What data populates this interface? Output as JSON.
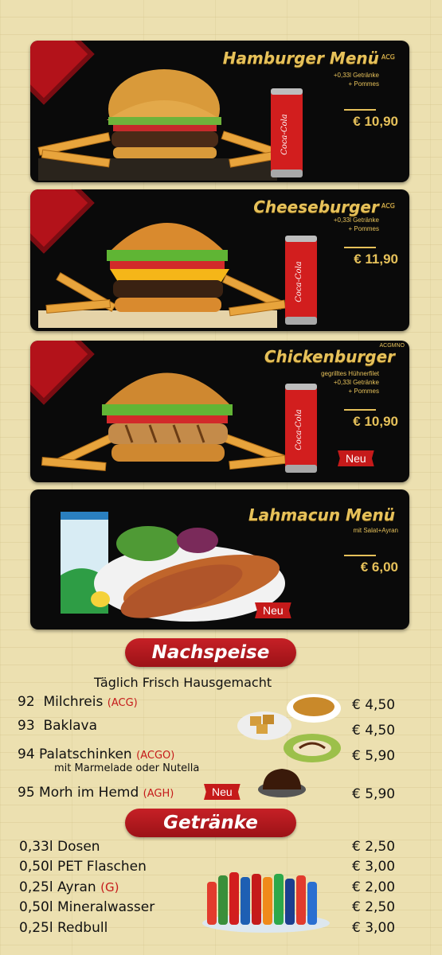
{
  "menus": [
    {
      "title": "Hamburger Menü",
      "allergen": "ACG",
      "sub": [
        "+0,33l Getränke",
        "+ Pommes"
      ],
      "price": "€ 10,90"
    },
    {
      "title": "Cheeseburger",
      "allergen": "ACG",
      "sub": [
        "+0,33l Getränke",
        "+ Pommes"
      ],
      "price": "€ 11,90"
    },
    {
      "title": "Chickenburger",
      "allergen": "ACGMNO",
      "sub": [
        "gegrilltes Hühnerfilet",
        "+0,33l Getränke",
        "+ Pommes"
      ],
      "price": "€ 10,90",
      "badge": "Neu"
    },
    {
      "title": "Lahmacun Menü",
      "allergen": "",
      "sub": [
        "mit Salat+Ayran"
      ],
      "price": "€ 6,00",
      "badge": "Neu"
    }
  ],
  "can_label": "Coca-Cola",
  "dessert": {
    "heading": "Nachspeise",
    "tagline": "Täglich Frisch Hausgemacht",
    "items": [
      {
        "num": "92",
        "name": "Milchreis",
        "allergen": "(ACG)",
        "price": "€ 4,50"
      },
      {
        "num": "93",
        "name": "Baklava",
        "allergen": "",
        "price": "€ 4,50"
      },
      {
        "num": "94",
        "name": "Palatschinken",
        "allergen": "(ACGO)",
        "note": "mit Marmelade oder Nutella",
        "price": "€ 5,90"
      },
      {
        "num": "95",
        "name": "Morh im Hemd",
        "allergen": "(AGH)",
        "badge": "Neu",
        "price": "€ 5,90"
      }
    ]
  },
  "drinks": {
    "heading": "Getränke",
    "items": [
      {
        "name": "0,33l Dosen",
        "allergen": "",
        "price": "€ 2,50"
      },
      {
        "name": "0,50l PET Flaschen",
        "allergen": "",
        "price": "€ 3,00"
      },
      {
        "name": "0,25l Ayran",
        "allergen": "(G)",
        "price": "€ 2,00"
      },
      {
        "name": "0,50l Mineralwasser",
        "allergen": "",
        "price": "€ 2,50"
      },
      {
        "name": "0,25l Redbull",
        "allergen": "",
        "price": "€ 3,00"
      }
    ]
  },
  "colors": {
    "gold": "#e6c15a",
    "red": "#c51a1a",
    "card": "#0a0a0a"
  }
}
